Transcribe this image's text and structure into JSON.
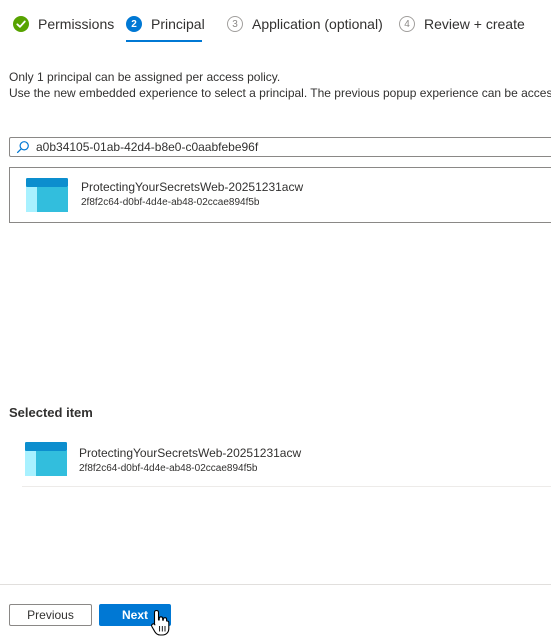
{
  "wizard": {
    "tabs": [
      {
        "number": "",
        "label": "Permissions",
        "state": "done",
        "icon": "checkmark-icon"
      },
      {
        "number": "2",
        "label": "Principal",
        "state": "current"
      },
      {
        "number": "3",
        "label": "Application (optional)",
        "state": "todo"
      },
      {
        "number": "4",
        "label": "Review + create",
        "state": "todo"
      }
    ]
  },
  "info": {
    "line1": "Only 1 principal can be assigned per access policy.",
    "line2": "Use the new embedded experience to select a principal. The previous popup experience can be accessed"
  },
  "search": {
    "value": "a0b34105-01ab-42d4-b8e0-c0aabfebe96f",
    "icon": "search-icon"
  },
  "results": [
    {
      "name": "ProtectingYourSecretsWeb-20251231acw",
      "id": "2f8f2c64-d0bf-4d4e-ab48-02ccae894f5b",
      "icon": "app-registration-icon"
    }
  ],
  "selected": {
    "heading": "Selected item",
    "items": [
      {
        "name": "ProtectingYourSecretsWeb-20251231acw",
        "id": "2f8f2c64-d0bf-4d4e-ab48-02ccae894f5b",
        "icon": "app-registration-icon"
      }
    ]
  },
  "footer": {
    "previous_label": "Previous",
    "next_label": "Next"
  },
  "colors": {
    "accent": "#0078d4",
    "success": "#57a300",
    "app_icon_dark": "#0c8ece",
    "app_icon_light": "#50e6ff"
  }
}
